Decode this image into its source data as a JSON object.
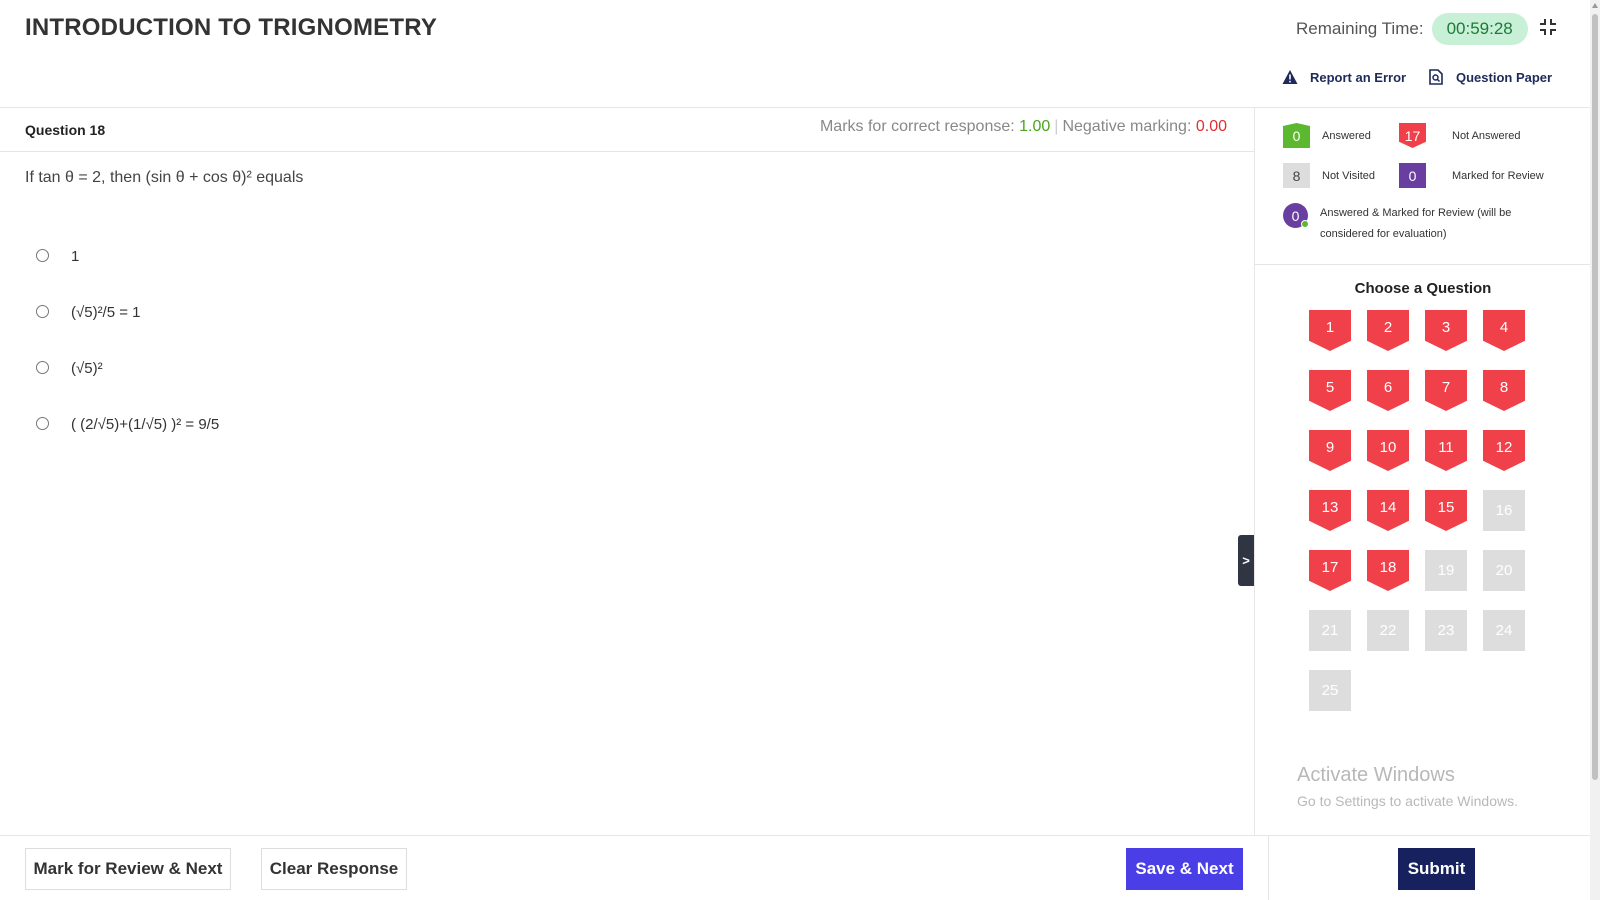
{
  "header": {
    "title": "INTRODUCTION TO TRIGNOMETRY",
    "remaining_time_label": "Remaining Time:",
    "remaining_time_value": "00:59:28",
    "report_error_label": "Report an Error",
    "question_paper_label": "Question Paper"
  },
  "question": {
    "number_label": "Question 18",
    "marks_correct_label": "Marks for correct response:",
    "marks_correct_value": "1.00",
    "separator": "|",
    "negative_label": "Negative marking:",
    "negative_value": "0.00",
    "text": "If tan θ = 2, then (sin θ + cos θ)² equals",
    "options": [
      {
        "label": "1"
      },
      {
        "label": "(√5)²/5 = 1"
      },
      {
        "label": "(√5)²"
      },
      {
        "label": "( (2/√5)+(1/√5) )² = 9/5"
      }
    ]
  },
  "side_toggle": ">",
  "legend": {
    "answered": {
      "count": "0",
      "label": "Answered"
    },
    "not_answered": {
      "count": "17",
      "label": "Not Answered"
    },
    "not_visited": {
      "count": "8",
      "label": "Not Visited"
    },
    "marked_review": {
      "count": "0",
      "label": "Marked for Review"
    },
    "answered_marked": {
      "count": "0",
      "label": "Answered & Marked for Review (will be considered for evaluation)"
    }
  },
  "palette": {
    "title": "Choose a Question",
    "questions": [
      {
        "n": "1",
        "status": "not-answered"
      },
      {
        "n": "2",
        "status": "not-answered"
      },
      {
        "n": "3",
        "status": "not-answered"
      },
      {
        "n": "4",
        "status": "not-answered"
      },
      {
        "n": "5",
        "status": "not-answered"
      },
      {
        "n": "6",
        "status": "not-answered"
      },
      {
        "n": "7",
        "status": "not-answered"
      },
      {
        "n": "8",
        "status": "not-answered"
      },
      {
        "n": "9",
        "status": "not-answered"
      },
      {
        "n": "10",
        "status": "not-answered"
      },
      {
        "n": "11",
        "status": "not-answered"
      },
      {
        "n": "12",
        "status": "not-answered"
      },
      {
        "n": "13",
        "status": "not-answered"
      },
      {
        "n": "14",
        "status": "not-answered"
      },
      {
        "n": "15",
        "status": "not-answered"
      },
      {
        "n": "16",
        "status": "not-visited"
      },
      {
        "n": "17",
        "status": "not-answered"
      },
      {
        "n": "18",
        "status": "not-answered"
      },
      {
        "n": "19",
        "status": "not-visited"
      },
      {
        "n": "20",
        "status": "not-visited"
      },
      {
        "n": "21",
        "status": "not-visited"
      },
      {
        "n": "22",
        "status": "not-visited"
      },
      {
        "n": "23",
        "status": "not-visited"
      },
      {
        "n": "24",
        "status": "not-visited"
      },
      {
        "n": "25",
        "status": "not-visited"
      }
    ]
  },
  "watermark": {
    "line1": "Activate Windows",
    "line2": "Go to Settings to activate Windows."
  },
  "footer": {
    "mark_review_label": "Mark for Review & Next",
    "clear_label": "Clear Response",
    "save_next_label": "Save & Next",
    "submit_label": "Submit"
  },
  "colors": {
    "not_answered": "#f0404a",
    "answered": "#5cb82e",
    "not_visited": "#dddddd",
    "marked": "#6a3ea1",
    "save_button": "#4a3ee6",
    "submit_button": "#16215e",
    "timer_bg": "#c7f0d6"
  },
  "icons": {
    "collapse": "collapse-fullscreen-icon",
    "report": "warning-triangle-icon",
    "paper": "document-search-icon"
  }
}
